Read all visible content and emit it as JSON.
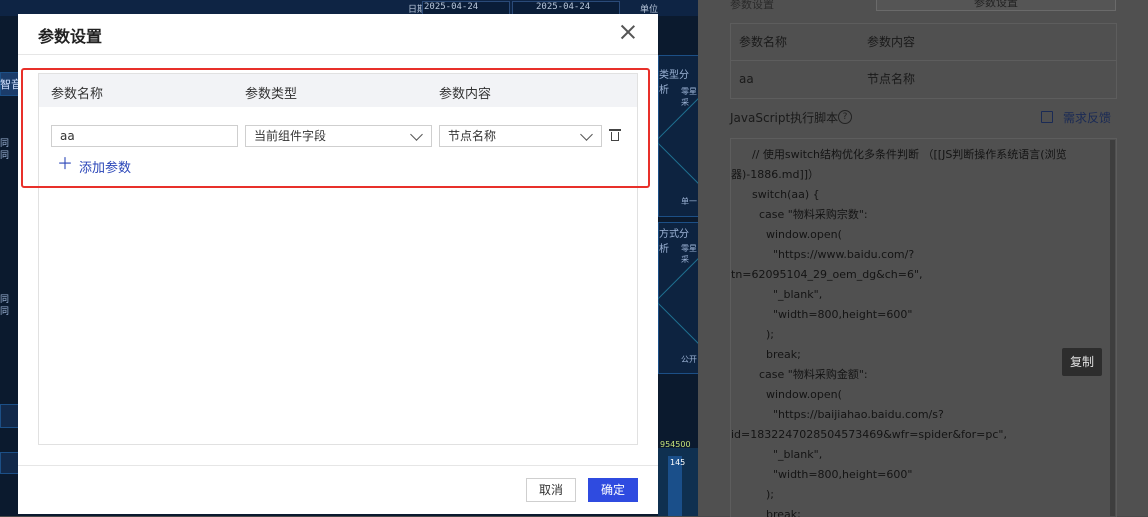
{
  "background": {
    "date_label": "日期",
    "date_start": "2025-04-24",
    "date_end": "2025-04-24",
    "unit_label": "单位",
    "side_label": "智音",
    "chart_labels": [
      "类型分析",
      "方式分析",
      "单一",
      "公开",
      "零星采",
      "零星采",
      "954500",
      "145"
    ]
  },
  "right_panel": {
    "top_label": "参数设置",
    "top_button": "参数设置",
    "table": {
      "headers": [
        "参数名称",
        "参数内容"
      ],
      "rows": [
        [
          "aa",
          "节点名称"
        ]
      ]
    },
    "js_title": "JavaScript执行脚本",
    "help_icon": "question-circle-icon",
    "feedback_label": "需求反馈",
    "feedback_icon": "edit-icon",
    "copy_label": "复制",
    "code_lines": [
      "      // 使用switch结构优化多条件判断 （[[JS判断操作系统语言(浏览",
      "器)-1886.md]]）",
      "      switch(aa) {",
      "        case \"物料采购宗数\":",
      "          window.open(",
      "            \"https://www.baidu.com/?",
      "tn=62095104_29_oem_dg&ch=6\",",
      "            \"_blank\",",
      "            \"width=800,height=600\"",
      "          );",
      "          break;",
      "        case \"物料采购金额\":",
      "          window.open(",
      "            \"https://baijiahao.baidu.com/s?",
      "id=1832247028504573469&wfr=spider&for=pc\",",
      "            \"_blank\",",
      "            \"width=800,height=600\"",
      "          );",
      "          break;"
    ]
  },
  "modal": {
    "title": "参数设置",
    "close_icon": "close-icon",
    "columns": [
      "参数名称",
      "参数类型",
      "参数内容"
    ],
    "row": {
      "name_value": "aa",
      "type_value": "当前组件字段",
      "content_value": "节点名称"
    },
    "delete_icon": "trash-icon",
    "add_icon": "plus-icon",
    "add_label": "添加参数",
    "cancel_label": "取消",
    "ok_label": "确定"
  },
  "colors": {
    "highlight": "#e8302a",
    "primary": "#2f4be0",
    "link": "#2b46b8"
  }
}
